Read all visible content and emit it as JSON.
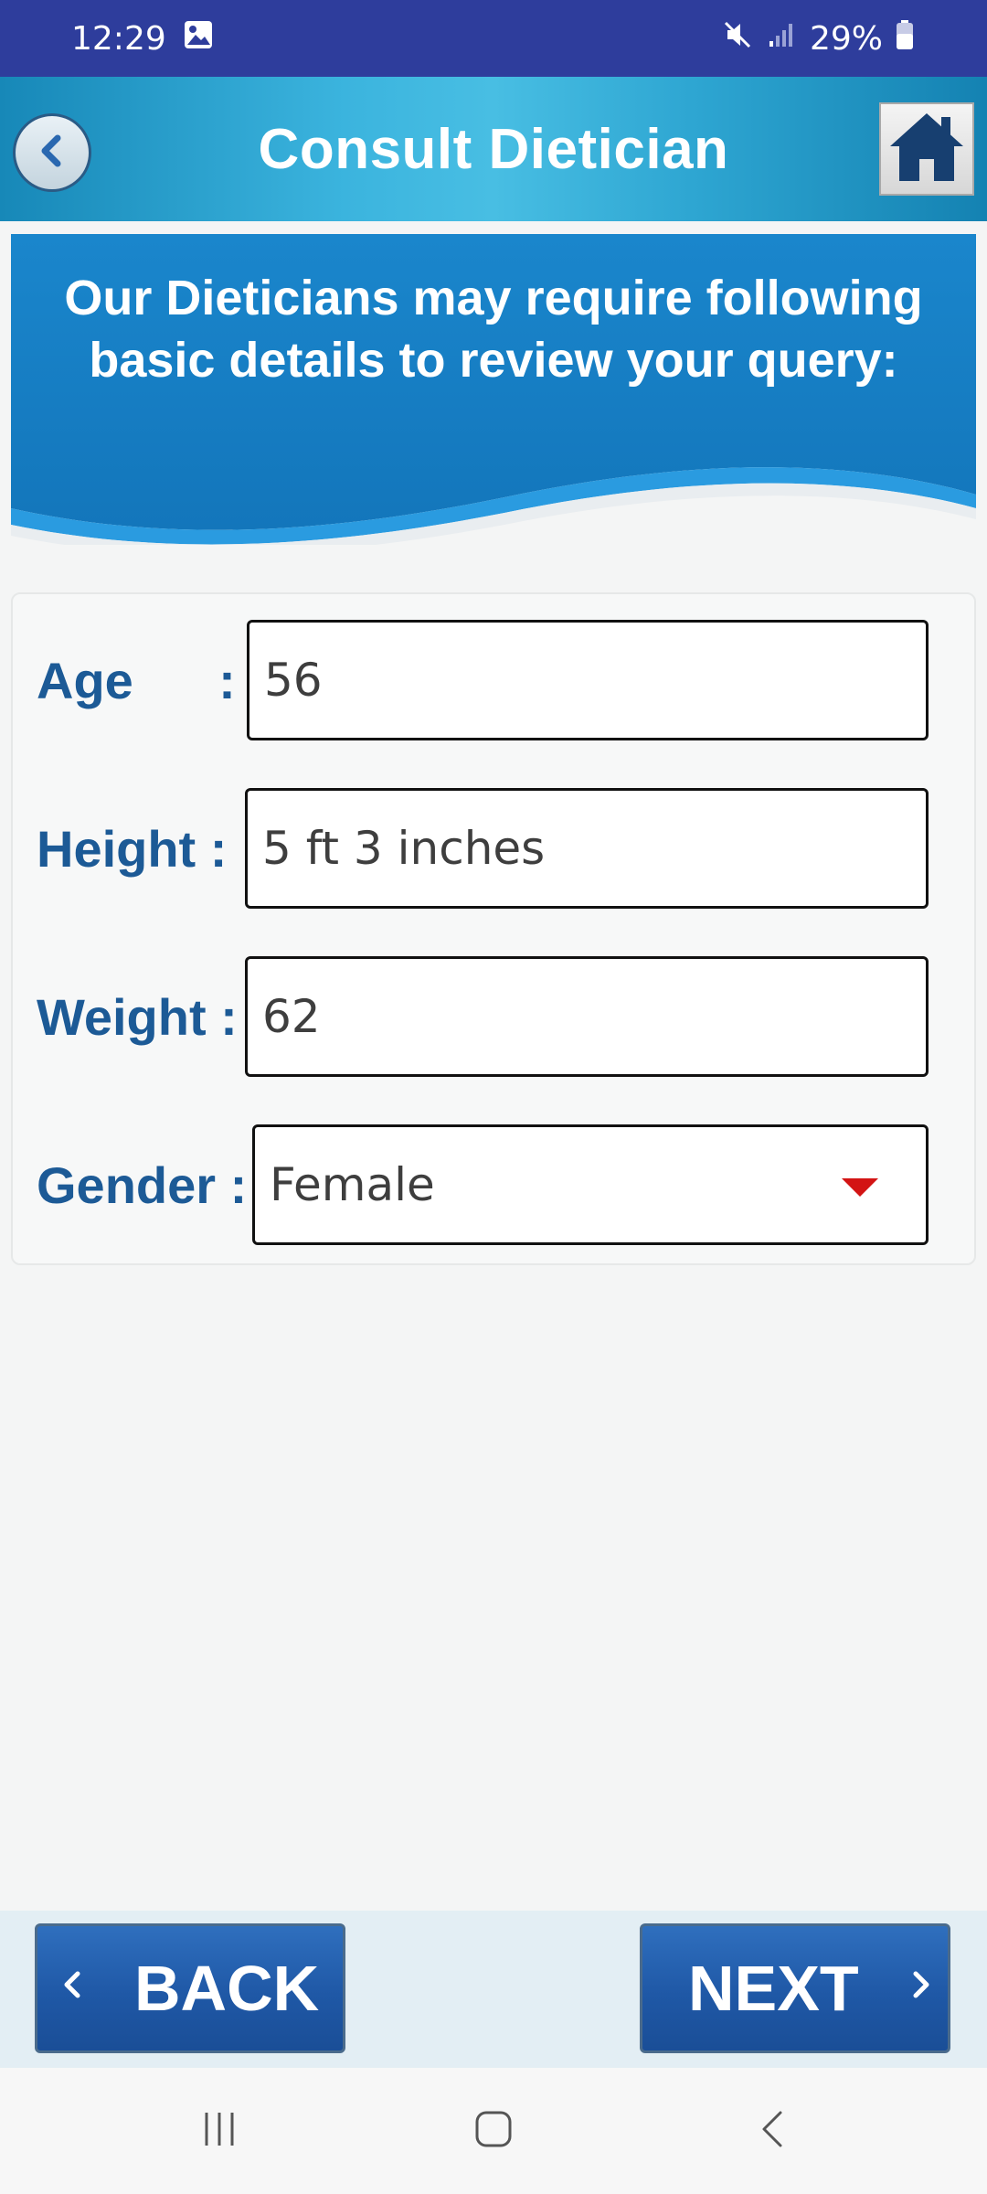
{
  "status_bar": {
    "time": "12:29",
    "battery": "29%",
    "icons": [
      "image-icon",
      "mute-icon",
      "signal-icon",
      "battery-icon"
    ]
  },
  "header": {
    "title": "Consult Dietician",
    "back_icon": "back-chevron-icon",
    "home_icon": "home-icon"
  },
  "banner": {
    "line1": "Our Dieticians may require following",
    "line2": "basic details to review your query:"
  },
  "form": {
    "age": {
      "label": "Age      :",
      "value": "56"
    },
    "height": {
      "label": "Height :",
      "value": "5 ft 3 inches"
    },
    "weight": {
      "label": "Weight :",
      "value": "62"
    },
    "gender": {
      "label": "Gender :",
      "value": "Female"
    }
  },
  "footer": {
    "back_label": "BACK",
    "next_label": "NEXT"
  },
  "colors": {
    "status_bar": "#2e3d9c",
    "header_accent": "#3bb4de",
    "label_blue": "#1c5a96",
    "button_blue": "#1f58a6",
    "dropdown_arrow": "#d31414"
  }
}
